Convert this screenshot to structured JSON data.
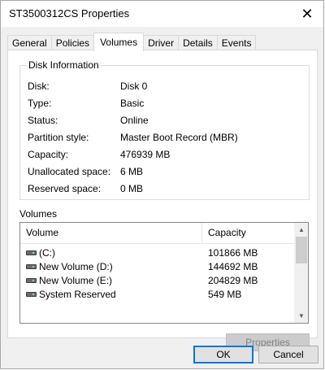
{
  "window": {
    "title": "ST3500312CS Properties",
    "close_glyph": "✕"
  },
  "tabs": [
    {
      "label": "General"
    },
    {
      "label": "Policies"
    },
    {
      "label": "Volumes",
      "active": true
    },
    {
      "label": "Driver"
    },
    {
      "label": "Details"
    },
    {
      "label": "Events"
    }
  ],
  "disk_info": {
    "group_label": "Disk Information",
    "rows": [
      {
        "label": "Disk:",
        "value": "Disk 0"
      },
      {
        "label": "Type:",
        "value": "Basic"
      },
      {
        "label": "Status:",
        "value": "Online"
      },
      {
        "label": "Partition style:",
        "value": "Master Boot Record (MBR)"
      },
      {
        "label": "Capacity:",
        "value": "476939 MB"
      },
      {
        "label": "Unallocated space:",
        "value": "6 MB"
      },
      {
        "label": "Reserved space:",
        "value": "0 MB"
      }
    ]
  },
  "volumes": {
    "label": "Volumes",
    "columns": [
      "Volume",
      "Capacity"
    ],
    "rows": [
      {
        "name": " (C:)",
        "capacity": "101866 MB"
      },
      {
        "name": "New Volume (D:)",
        "capacity": "144692 MB"
      },
      {
        "name": "New Volume (E:)",
        "capacity": "204829 MB"
      },
      {
        "name": "System Reserved",
        "capacity": "549 MB"
      }
    ],
    "icon": "drive-icon"
  },
  "buttons": {
    "properties": "Properties",
    "ok": "OK",
    "cancel": "Cancel"
  },
  "colors": {
    "accent": "#0078d7",
    "panel_bg": "#f0f0f0",
    "disabled_text": "#838383"
  }
}
